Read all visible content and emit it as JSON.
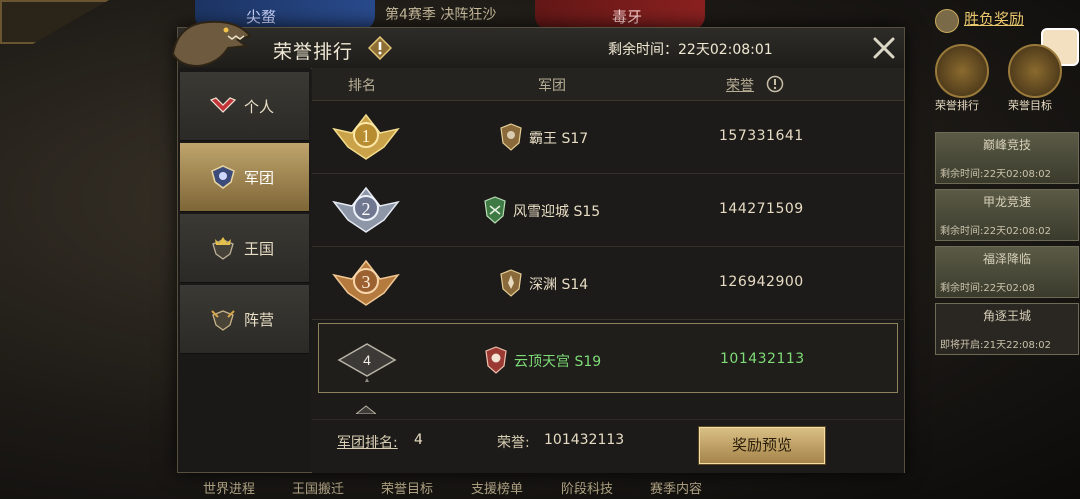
{
  "background": {
    "season_text": "第4赛季  决阵狂沙",
    "left_name": "尖蝥",
    "right_name": "毒牙",
    "reward_link": "胜负奖励",
    "icons": [
      {
        "label": "荣誉排行"
      },
      {
        "label": "荣誉目标"
      }
    ],
    "cards": [
      {
        "title": "巅峰竞技",
        "sub": "剩余时间:22天02:08:02"
      },
      {
        "title": "甲龙竞速",
        "sub": "剩余时间:22天02:08:02"
      },
      {
        "title": "福泽降临",
        "sub": "剩余时间:22天02:08"
      },
      {
        "title": "角逐王城",
        "sub": "即将开启:21天22:08:02"
      }
    ],
    "bottom_tabs": [
      "世界进程",
      "王国搬迁",
      "荣誉目标",
      "支援榜单",
      "阶段科技",
      "赛季内容"
    ]
  },
  "modal": {
    "title": "荣誉排行",
    "remain_time": "剩余时间：22天02:08:01"
  },
  "side_tabs": [
    {
      "label": "个人",
      "icon": "chevron-rank-icon",
      "active": false
    },
    {
      "label": "军团",
      "icon": "legion-shield-icon",
      "active": true
    },
    {
      "label": "王国",
      "icon": "crown-shield-icon",
      "active": false
    },
    {
      "label": "阵营",
      "icon": "faction-shield-icon",
      "active": false
    }
  ],
  "table": {
    "headers": {
      "rank": "排名",
      "legion": "军团",
      "honor": "荣誉"
    },
    "rows": [
      {
        "rank": "1",
        "legion": "霸王  S17",
        "honor": "157331641",
        "highlight": false
      },
      {
        "rank": "2",
        "legion": "风雪迎城  S15",
        "honor": "144271509",
        "highlight": false
      },
      {
        "rank": "3",
        "legion": "深渊  S14",
        "honor": "126942900",
        "highlight": false
      },
      {
        "rank": "4",
        "legion": "云顶天宫  S19",
        "honor": "101432113",
        "highlight": true
      }
    ]
  },
  "footer": {
    "rank_label": "军团排名:",
    "rank_value": "4",
    "honor_label": "荣誉:",
    "honor_value": "101432113",
    "preview_button": "奖励预览"
  },
  "colors": {
    "gold": "#c9a959",
    "highlight_green": "#7fdc77",
    "active_tab": "#bfa46c"
  }
}
